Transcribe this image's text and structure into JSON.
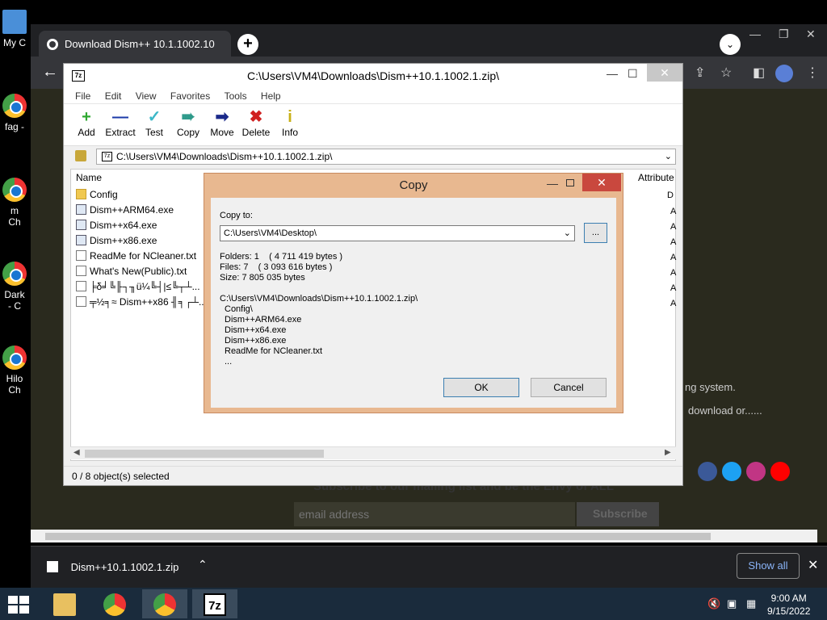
{
  "desktop": {
    "icons": [
      {
        "label": "My C",
        "kind": "pc"
      },
      {
        "label": "fag -",
        "kind": "chrome"
      },
      {
        "label": "m\nCh",
        "kind": "chrome"
      },
      {
        "label": "Dark\n- C",
        "kind": "chrome"
      },
      {
        "label": "Hilo\nCh",
        "kind": "chrome"
      }
    ]
  },
  "chrome": {
    "tab_title": "Download Dism++ 10.1.1002.10",
    "new_tab": "+",
    "tab_search": "v",
    "page_text": {
      "line1": "ng system.",
      "line2": "download or......",
      "subscribe_title": "Subscribe to our mailing list and be the Envy of ALL",
      "email_placeholder": "email address",
      "subscribe_button": "Subscribe"
    },
    "social_colors": [
      "#3b5998",
      "#1da1f2",
      "#c13584",
      "#ff0000"
    ]
  },
  "downloads_bar": {
    "file_name": "Dism++10.1.1002.1.zip",
    "show_all": "Show all"
  },
  "taskbar": {
    "time": "9:00 AM",
    "date": "9/15/2022"
  },
  "zip": {
    "title": "C:\\Users\\VM4\\Downloads\\Dism++10.1.1002.1.zip\\",
    "app_icon": "7z",
    "menu": [
      "File",
      "Edit",
      "View",
      "Favorites",
      "Tools",
      "Help"
    ],
    "toolbar": [
      {
        "label": "Add",
        "glyph": "+",
        "color": "#2ea830"
      },
      {
        "label": "Extract",
        "glyph": "—",
        "color": "#1b3aa8"
      },
      {
        "label": "Test",
        "glyph": "✓",
        "color": "#3db8c8"
      },
      {
        "label": "Copy",
        "glyph": "➠",
        "color": "#2e9a8a"
      },
      {
        "label": "Move",
        "glyph": "➡",
        "color": "#1b2a8a"
      },
      {
        "label": "Delete",
        "glyph": "✖",
        "color": "#d02020"
      },
      {
        "label": "Info",
        "glyph": "i",
        "color": "#c8b018"
      }
    ],
    "address": "C:\\Users\\VM4\\Downloads\\Dism++10.1.1002.1.zip\\",
    "columns": {
      "name": "Name",
      "attributes": "Attribute"
    },
    "attr_values": [
      "D",
      "A",
      "A",
      "A",
      "A",
      "A",
      "A",
      "A"
    ],
    "files": [
      {
        "name": "Config",
        "type": "folder"
      },
      {
        "name": "Dism++ARM64.exe",
        "type": "exe"
      },
      {
        "name": "Dism++x64.exe",
        "type": "exe"
      },
      {
        "name": "Dism++x86.exe",
        "type": "exe"
      },
      {
        "name": "ReadMe for NCleaner.txt",
        "type": "txt"
      },
      {
        "name": "What's New(Public).txt",
        "type": "txt"
      },
      {
        "name": "╞δ╛╚╟┐╖ü¼╚┤|≤╚┬┴...",
        "type": "txt"
      },
      {
        "name": "╤½╕≈ Dism++x86 ╢╕┌┴...",
        "type": "txt"
      }
    ],
    "status": "0 / 8 object(s) selected"
  },
  "dialog": {
    "title": "Copy",
    "copy_to_label": "Copy to:",
    "copy_to_value": "C:\\Users\\VM4\\Desktop\\",
    "browse": "...",
    "folders": "Folders: 1    ( 4 711 419 bytes )",
    "files_count": "Files: 7    ( 3 093 616 bytes )",
    "size": "Size: 7 805 035 bytes",
    "source_path": "C:\\Users\\VM4\\Downloads\\Dism++10.1.1002.1.zip\\",
    "source_items": [
      "Config\\",
      "Dism++ARM64.exe",
      "Dism++x64.exe",
      "Dism++x86.exe",
      "ReadMe for NCleaner.txt",
      "..."
    ],
    "ok": "OK",
    "cancel": "Cancel"
  }
}
